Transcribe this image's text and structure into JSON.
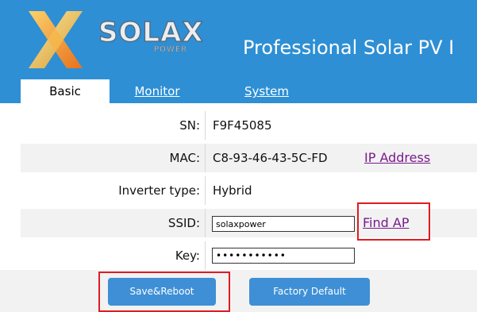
{
  "brand": {
    "name": "SOLAX",
    "sub": "POWER",
    "tagline": "Professional Solar PV I"
  },
  "tabs": [
    {
      "label": "Basic",
      "active": true
    },
    {
      "label": "Monitor",
      "active": false
    },
    {
      "label": "System",
      "active": false
    }
  ],
  "fields": {
    "sn": {
      "label": "SN:",
      "value": "F9F45085"
    },
    "mac": {
      "label": "MAC:",
      "value": "C8-93-46-43-5C-FD",
      "link": "IP Address"
    },
    "inverter": {
      "label": "Inverter type:",
      "value": "Hybrid"
    },
    "ssid": {
      "label": "SSID:",
      "value": "solaxpower",
      "link": "Find AP"
    },
    "key": {
      "label": "Key:",
      "value": "solaxpower1"
    }
  },
  "buttons": {
    "save": "Save&Reboot",
    "factory": "Factory Default"
  },
  "colors": {
    "header_bg": "#2e8fd4",
    "button_bg": "#3e8fd6",
    "link": "#7a1a8c",
    "highlight": "#e11b22",
    "row_alt": "#f2f2f2"
  }
}
